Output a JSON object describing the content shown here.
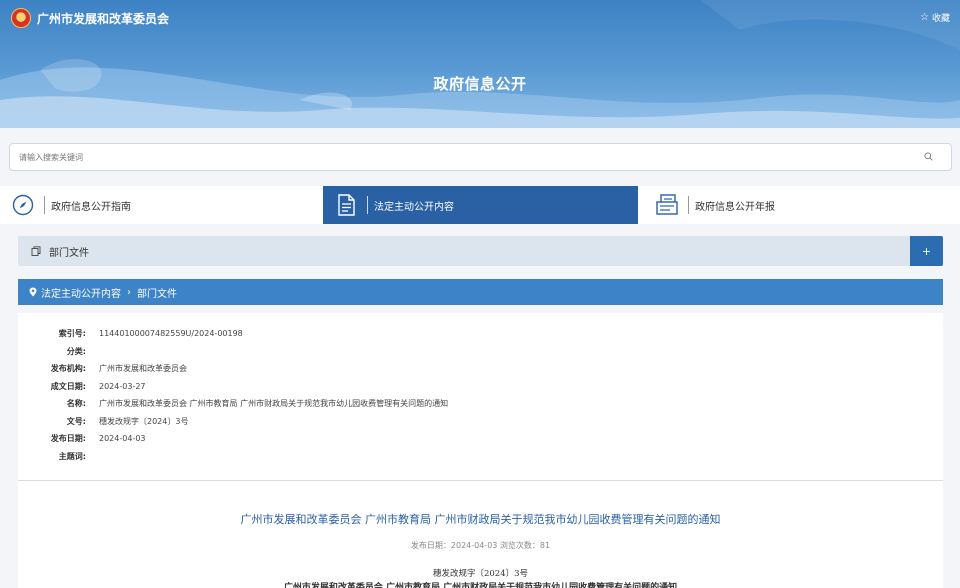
{
  "header": {
    "site_title": "广州市发展和改革委员会",
    "favorite_label": "收藏",
    "banner_title": "政府信息公开"
  },
  "search": {
    "placeholder": "请输入搜索关键词"
  },
  "tabs": [
    {
      "label": "政府信息公开指南",
      "icon": "compass-icon",
      "active": false
    },
    {
      "label": "法定主动公开内容",
      "icon": "document-icon",
      "active": true
    },
    {
      "label": "政府信息公开年报",
      "icon": "report-icon",
      "active": false
    }
  ],
  "dept_bar": {
    "label": "部门文件",
    "expand_symbol": "+"
  },
  "breadcrumb": {
    "items": [
      "法定主动公开内容",
      "部门文件"
    ]
  },
  "meta": {
    "rows": [
      {
        "key": "索引号:",
        "value": "11440100007482559U/2024-00198"
      },
      {
        "key": "分类:",
        "value": ""
      },
      {
        "key": "发布机构:",
        "value": "广州市发展和改革委员会"
      },
      {
        "key": "成文日期:",
        "value": "2024-03-27"
      },
      {
        "key": "名称:",
        "value": "广州市发展和改革委员会 广州市教育局 广州市财政局关于规范我市幼儿园收费管理有关问题的通知"
      },
      {
        "key": "文号:",
        "value": "穗发改规字〔2024〕3号"
      },
      {
        "key": "发布日期:",
        "value": "2024-04-03"
      },
      {
        "key": "主题词:",
        "value": ""
      }
    ]
  },
  "document": {
    "title": "广州市发展和改革委员会 广州市教育局 广州市财政局关于规范我市幼儿园收费管理有关问题的通知",
    "info": "发布日期：2024-04-03   浏览次数：81",
    "number": "穗发改规字〔2024〕3号",
    "heading_partial": "广州市发展和改革委员会 广州市教育局 广州市财政局关于规范我市幼儿园收费管理有关问题的通知"
  },
  "colors": {
    "primary": "#2a61a4",
    "breadcrumb_bg": "#3d83c7",
    "dept_bar_bg": "#dce5ee"
  }
}
